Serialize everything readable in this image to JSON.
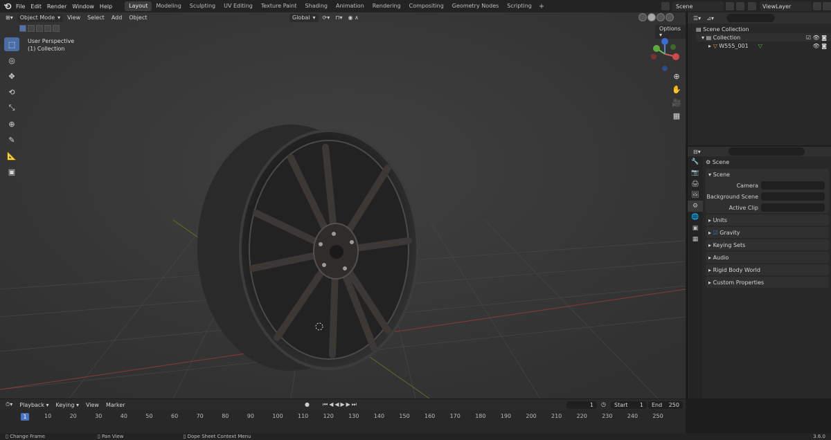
{
  "menu": [
    "File",
    "Edit",
    "Render",
    "Window",
    "Help"
  ],
  "workspaces": [
    "Layout",
    "Modeling",
    "Sculpting",
    "UV Editing",
    "Texture Paint",
    "Shading",
    "Animation",
    "Rendering",
    "Compositing",
    "Geometry Nodes",
    "Scripting"
  ],
  "active_workspace": "Layout",
  "top_right": {
    "scene": "Scene",
    "view_layer": "ViewLayer"
  },
  "viewport": {
    "mode": "Object Mode",
    "menus": [
      "View",
      "Select",
      "Add",
      "Object"
    ],
    "transform_orientation": "Global",
    "overlay_line1": "User Perspective",
    "overlay_line2": "(1) Collection",
    "options_label": "Options"
  },
  "outliner": {
    "scene_collection": "Scene Collection",
    "collection": "Collection",
    "object": "W555_001"
  },
  "properties": {
    "title": "Scene",
    "panel_scene": "Scene",
    "camera_label": "Camera",
    "background_scene_label": "Background Scene",
    "active_clip_label": "Active Clip",
    "collapsed_panels": [
      "Units",
      "Gravity",
      "Keying Sets",
      "Audio",
      "Rigid Body World",
      "Custom Properties"
    ]
  },
  "timeline": {
    "menus": [
      "Playback",
      "Keying",
      "View",
      "Marker"
    ],
    "current_frame": "1",
    "start_label": "Start",
    "start": "1",
    "end_label": "End",
    "end": "250",
    "frame_ticks": [
      "10",
      "20",
      "30",
      "40",
      "50",
      "60",
      "70",
      "80",
      "90",
      "100",
      "110",
      "120",
      "130",
      "140",
      "150",
      "160",
      "170",
      "180",
      "190",
      "200",
      "210",
      "220",
      "230",
      "240",
      "250"
    ]
  },
  "status": {
    "left": "Change Frame",
    "mid": "Pan View",
    "right": "Dope Sheet Context Menu",
    "version": "3.6.0"
  },
  "colors": {
    "accent": "#4a73c0",
    "viewport_bg": "#393939"
  }
}
